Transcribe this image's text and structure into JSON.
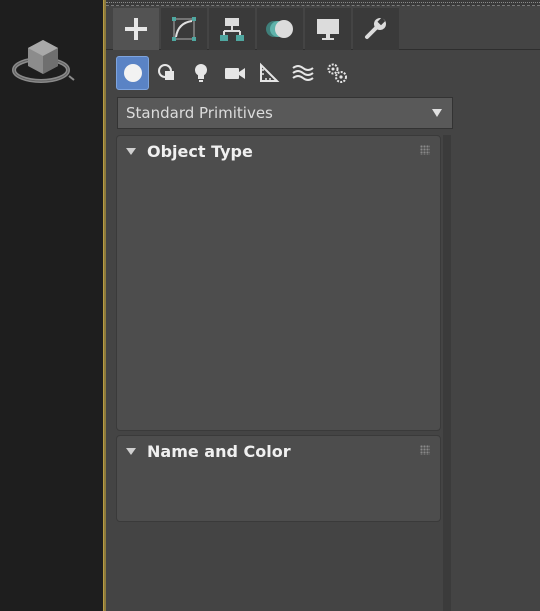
{
  "command_panel": {
    "tabs": [
      {
        "icon": "create-plus-icon",
        "active": true
      },
      {
        "icon": "modify-curve-icon",
        "active": false
      },
      {
        "icon": "hierarchy-icon",
        "active": false
      },
      {
        "icon": "motion-icon",
        "active": false
      },
      {
        "icon": "display-monitor-icon",
        "active": false
      },
      {
        "icon": "utilities-wrench-icon",
        "active": false
      }
    ],
    "subtabs": [
      {
        "icon": "geometry-sphere-icon",
        "active": true
      },
      {
        "icon": "shapes-icon",
        "active": false
      },
      {
        "icon": "lights-bulb-icon",
        "active": false
      },
      {
        "icon": "cameras-icon",
        "active": false
      },
      {
        "icon": "helpers-ruler-icon",
        "active": false
      },
      {
        "icon": "space-warps-icon",
        "active": false
      },
      {
        "icon": "systems-gears-icon",
        "active": false
      }
    ],
    "category_dropdown": {
      "selected": "Standard Primitives"
    },
    "rollouts": {
      "object_type": {
        "title": "Object Type"
      },
      "name_and_color": {
        "title": "Name and Color"
      }
    }
  },
  "colors": {
    "panel_bg": "#444444",
    "viewport_bg": "#1e1e1e",
    "active_subtab": "#5a83c5",
    "viewport_border": "#8d7a3c"
  }
}
